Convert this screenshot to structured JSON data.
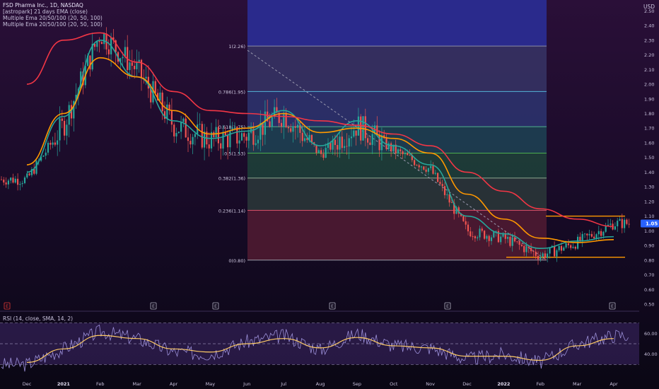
{
  "header": {
    "title": "FSD Pharma Inc., 1D, NASDAQ",
    "indicator_1": "[astropark] 21 days EMA (close)",
    "indicator_2": "Multiple Ema 20/50/100 (20, 50, 100)",
    "indicator_3": "Multiple Ema 20/50/100 (20, 50, 100)",
    "currency": "USD"
  },
  "price_axis": {
    "ticks": [
      "2.50",
      "2.40",
      "2.30",
      "2.20",
      "2.10",
      "2.00",
      "1.90",
      "1.80",
      "1.70",
      "1.60",
      "1.50",
      "1.40",
      "1.30",
      "1.20",
      "1.10",
      "1.00",
      "0.90",
      "0.80",
      "0.70",
      "0.60",
      "0.50"
    ],
    "current_price": "1.05",
    "current_price_color": "#2962ff"
  },
  "time_axis": {
    "labels": [
      "Dec",
      "2021",
      "Feb",
      "Mar",
      "Apr",
      "May",
      "Jun",
      "Jul",
      "Aug",
      "Sep",
      "Oct",
      "Nov",
      "Dec",
      "2022",
      "Feb",
      "Mar",
      "Apr"
    ]
  },
  "fib_levels": [
    {
      "label": "1(2.26)",
      "price": 2.26,
      "color": "#8a8aa8"
    },
    {
      "label": "0.786(1.95)",
      "price": 1.95,
      "color": "#54b5d8"
    },
    {
      "label": "0.618(1.75)",
      "price": 1.71,
      "color": "#4fb28f"
    },
    {
      "label": "0.5(1.53)",
      "price": 1.53,
      "color": "#4caf50"
    },
    {
      "label": "0.382(1.36)",
      "price": 1.36,
      "color": "#8fa58f"
    },
    {
      "label": "0.236(1.14)",
      "price": 1.14,
      "color": "#e0506a"
    },
    {
      "label": "0(0.80)",
      "price": 0.8,
      "color": "#9a9aa8"
    }
  ],
  "earnings_markers": [
    "E",
    "E",
    "E",
    "E",
    "E",
    "E"
  ],
  "rsi": {
    "label": "RSI (14, close, SMA, 14, 2)",
    "ticks": [
      "60.00",
      "40.00"
    ]
  },
  "chart_data": {
    "type": "candlestick",
    "title": "FSD Pharma Inc., 1D, NASDAQ",
    "ylim": [
      0.5,
      2.55
    ],
    "x": [
      "Dec",
      "2021",
      "Feb",
      "Mar",
      "Apr",
      "May",
      "Jun",
      "Jul",
      "Aug",
      "Sep",
      "Oct",
      "Nov",
      "Dec",
      "2022",
      "Feb",
      "Mar",
      "Apr"
    ],
    "series": [
      {
        "name": "price (close)",
        "color": "#26a69a",
        "values": [
          1.35,
          1.72,
          2.35,
          2.1,
          1.72,
          1.62,
          1.65,
          1.8,
          1.52,
          1.72,
          1.55,
          1.42,
          1.0,
          0.95,
          0.83,
          0.92,
          1.05
        ]
      },
      {
        "name": "EMA 20",
        "color": "#26a69a",
        "values": [
          1.4,
          1.78,
          2.3,
          2.05,
          1.75,
          1.63,
          1.68,
          1.82,
          1.58,
          1.75,
          1.58,
          1.45,
          1.1,
          0.98,
          0.88,
          0.93,
          0.96
        ]
      },
      {
        "name": "EMA 50",
        "color": "#ff9800",
        "values": [
          1.45,
          1.8,
          2.18,
          2.05,
          1.82,
          1.66,
          1.7,
          1.8,
          1.67,
          1.7,
          1.63,
          1.53,
          1.25,
          1.08,
          0.95,
          0.92,
          0.94
        ]
      },
      {
        "name": "EMA 100",
        "color": "#f23645",
        "values": [
          2.0,
          2.3,
          2.35,
          2.15,
          1.95,
          1.82,
          1.8,
          1.78,
          1.75,
          1.72,
          1.66,
          1.58,
          1.4,
          1.27,
          1.15,
          1.08,
          1.03
        ]
      }
    ],
    "fibonacci": {
      "high": 2.26,
      "low": 0.8,
      "levels": [
        1,
        0.786,
        0.618,
        0.5,
        0.382,
        0.236,
        0
      ]
    },
    "range_box": {
      "top": 1.1,
      "bottom": 0.82
    },
    "rsi_series": {
      "name": "RSI",
      "ylim": [
        20,
        80
      ],
      "bands": [
        70,
        50,
        30
      ],
      "values": [
        30,
        45,
        62,
        55,
        42,
        40,
        52,
        58,
        44,
        60,
        48,
        46,
        35,
        40,
        32,
        50,
        58
      ]
    },
    "rsi_sma": {
      "values": [
        32,
        45,
        58,
        55,
        45,
        42,
        50,
        55,
        46,
        56,
        48,
        46,
        38,
        38,
        34,
        48,
        55
      ]
    }
  }
}
